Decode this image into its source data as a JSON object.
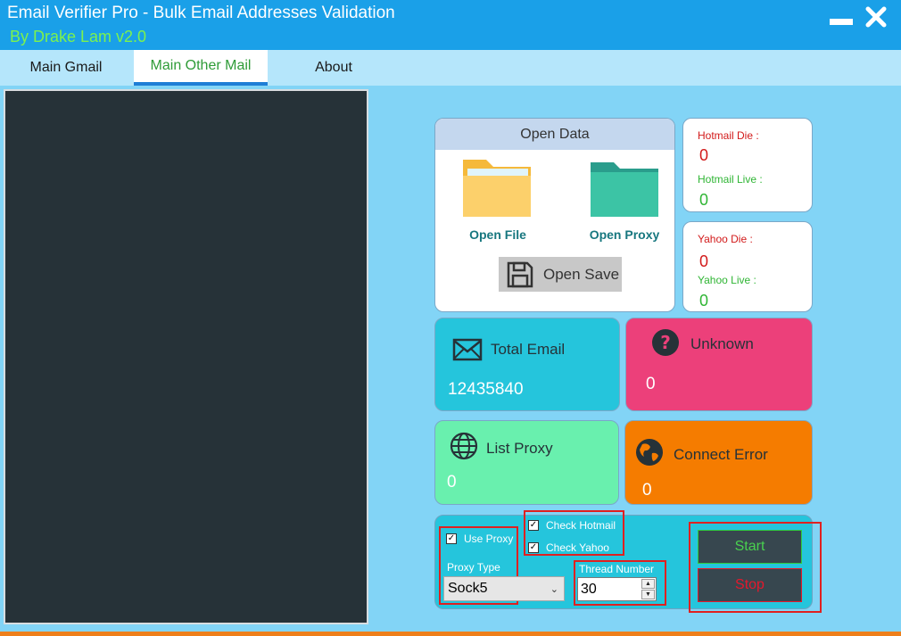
{
  "window": {
    "title": "Email Verifier Pro - Bulk Email Addresses Validation",
    "subtitle": "By Drake Lam  v2.0"
  },
  "tabs": [
    {
      "label": "Main Gmail",
      "active": false
    },
    {
      "label": "Main Other Mail",
      "active": true
    },
    {
      "label": "About",
      "active": false
    }
  ],
  "open_data": {
    "header": "Open Data",
    "open_file_label": "Open File",
    "open_proxy_label": "Open Proxy",
    "open_save_label": "Open Save"
  },
  "hotmail": {
    "die_label": "Hotmail Die :",
    "die_value": "0",
    "live_label": "Hotmail  Live :",
    "live_value": "0"
  },
  "yahoo": {
    "die_label": "Yahoo Die :",
    "die_value": "0",
    "live_label": "Yahoo  Live :",
    "live_value": "0"
  },
  "stats": {
    "total_email": {
      "label": "Total Email",
      "value": "12435840",
      "icon": "envelope-icon",
      "color": "#25c5dc"
    },
    "unknown": {
      "label": "Unknown",
      "value": "0",
      "icon": "question-circle-icon",
      "color": "#ec407a"
    },
    "list_proxy": {
      "label": "List Proxy",
      "value": "0",
      "icon": "globe-icon",
      "color": "#69f0ae"
    },
    "connect_error": {
      "label": "Connect Error",
      "value": "0",
      "icon": "earth-icon",
      "color": "#f57c00"
    }
  },
  "controls": {
    "use_proxy_label": "Use Proxy",
    "use_proxy_checked": true,
    "check_hotmail_label": "Check Hotmail",
    "check_hotmail_checked": true,
    "check_yahoo_label": "Check Yahoo",
    "check_yahoo_checked": true,
    "proxy_type_label": "Proxy Type",
    "proxy_type_value": "Sock5",
    "thread_number_label": "Thread Number",
    "thread_number_value": "30",
    "start_label": "Start",
    "stop_label": "Stop"
  },
  "colors": {
    "titlebar": "#1aa0e8",
    "background": "#82d4f6",
    "subtitle": "#7cf24e",
    "log_panel": "#263238",
    "highlight_box": "#e02020"
  }
}
